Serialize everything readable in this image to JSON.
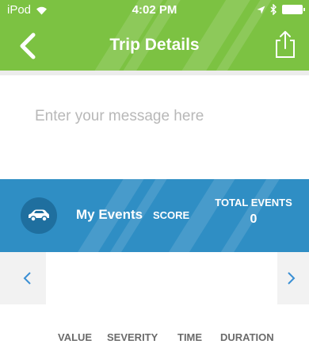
{
  "status_bar": {
    "carrier": "iPod",
    "time": "4:02 PM"
  },
  "header": {
    "title": "Trip Details",
    "color": "#7cc242"
  },
  "message": {
    "placeholder": "Enter your message here",
    "value": ""
  },
  "events_banner": {
    "title": "My Events",
    "score_label": "SCORE",
    "total_events_label": "TOTAL EVENTS",
    "total_events_value": "0",
    "color": "#2f8ec4"
  },
  "carousel": {
    "prev_icon": "chevron-left-icon",
    "next_icon": "chevron-right-icon"
  },
  "table": {
    "columns": [
      "VALUE",
      "SEVERITY",
      "TIME",
      "DURATION"
    ]
  }
}
